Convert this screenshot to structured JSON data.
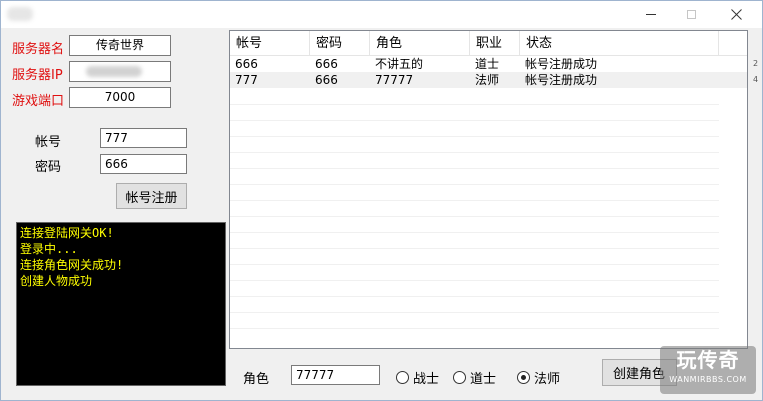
{
  "window": {
    "controls": {
      "minimize": "—",
      "maximize": "☐",
      "close": "✕"
    }
  },
  "server": {
    "name_label": "服务器名",
    "name_value": "传奇世界",
    "ip_label": "服务器IP",
    "port_label": "游戏端口",
    "port_value": "7000"
  },
  "account": {
    "account_label": "帐号",
    "account_value": "777",
    "password_label": "密码",
    "password_value": "666",
    "register_button": "帐号注册"
  },
  "console": {
    "lines": [
      "连接登陆网关OK!",
      "登录中...",
      "连接角色网关成功!",
      "创建人物成功"
    ]
  },
  "table": {
    "columns": [
      "帐号",
      "密码",
      "角色",
      "职业",
      "状态"
    ],
    "rows": [
      [
        "666",
        "666",
        "不讲五的",
        "道士",
        "帐号注册成功"
      ],
      [
        "777",
        "666",
        "77777",
        "法师",
        "帐号注册成功"
      ]
    ]
  },
  "role": {
    "label": "角色",
    "value": "77777",
    "classes": [
      {
        "label": "战士",
        "selected": false
      },
      {
        "label": "道士",
        "selected": false
      },
      {
        "label": "法师",
        "selected": true
      }
    ],
    "create_button": "创建角色"
  },
  "watermark": {
    "main": "玩传奇",
    "sub": "WANMIRBBS.COM"
  },
  "colors": {
    "label_red": "#e01010",
    "console_bg": "#000000",
    "console_text": "#ffff00"
  },
  "edge_marks": [
    "2",
    "4"
  ]
}
